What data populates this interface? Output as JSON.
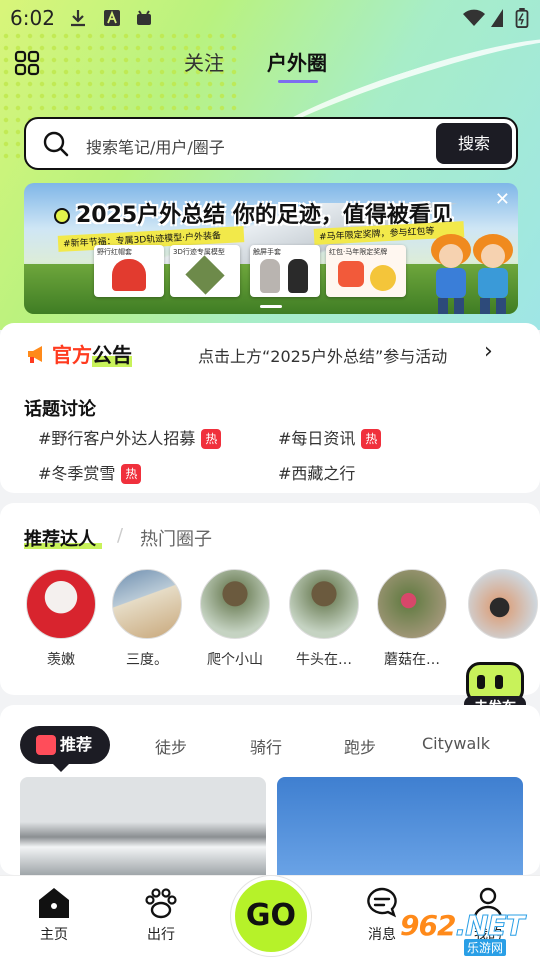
{
  "status_bar": {
    "time": "6:02"
  },
  "header": {
    "tabs": [
      {
        "label": "关注"
      },
      {
        "label": "户外圈"
      }
    ]
  },
  "search": {
    "placeholder": "搜索笔记/用户/圈子",
    "button_label": "搜索"
  },
  "banner": {
    "title": "2025户外总结 你的足迹，值得被看见",
    "ribbon_left": "#新年节福：专属3D轨迹模型·户外装备",
    "ribbon_right": "#马年限定奖牌，参与红包等",
    "cards": [
      "野行红帽套",
      "3D行迹专属模型",
      "触屏手套",
      "红包·马年限定奖牌"
    ]
  },
  "notice": {
    "logo_prefix": "官方",
    "logo_highlight": "公告",
    "text": "点击上方“2025户外总结”参与活动"
  },
  "topics": {
    "title": "话题讨论",
    "items": [
      {
        "label": "#野行客户外达人招募",
        "hot": "热"
      },
      {
        "label": "#每日资讯",
        "hot": "热"
      },
      {
        "label": "#冬季赏雪",
        "hot": "热"
      },
      {
        "label": "#西藏之行",
        "hot": ""
      }
    ]
  },
  "recommend": {
    "tab_active": "推荐达人",
    "tab_sep": "/",
    "tab_other": "热门圈子",
    "people": [
      {
        "name": "羡嫩"
      },
      {
        "name": "三度。"
      },
      {
        "name": "爬个小山"
      },
      {
        "name": "牛头在…"
      },
      {
        "name": "蘑菇在…"
      },
      {
        "name": ""
      }
    ]
  },
  "publish": {
    "label": "去发布"
  },
  "feed": {
    "chips": [
      {
        "label": "推荐"
      },
      {
        "label": "徒步"
      },
      {
        "label": "骑行"
      },
      {
        "label": "跑步"
      },
      {
        "label": "Citywalk"
      }
    ]
  },
  "bottom_nav": {
    "items": [
      {
        "label": "主页"
      },
      {
        "label": "出行"
      },
      {
        "label": "消息"
      },
      {
        "label": "我的"
      }
    ],
    "go_label": "GO"
  },
  "watermark": {
    "big": "962",
    "net": ".NET",
    "small": "乐游网"
  },
  "colors": {
    "accent_green": "#c8f25a",
    "go_green": "#b6f229",
    "tab_underline": "#7d6df0",
    "hot_red": "#f0303c",
    "notice_red": "#ff3b1f"
  }
}
